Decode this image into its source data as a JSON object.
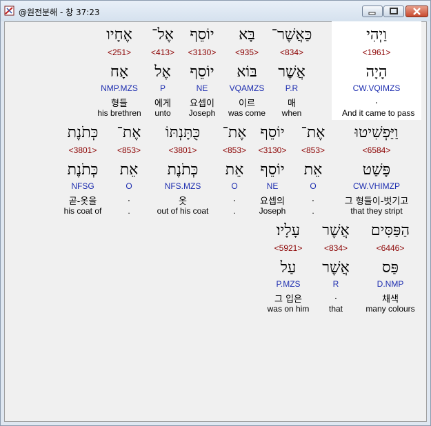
{
  "window": {
    "title": "@원전분해 - 창 37:23",
    "controls": {
      "minimize": "minimize-icon",
      "maximize": "maximize-icon",
      "close": "close-icon"
    },
    "accent": "#8b0000",
    "parse_color": "#1f2fb0"
  },
  "rows": [
    {
      "words": [
        {
          "heb": "וַיְהִי",
          "num": "<1961>",
          "lex": "הָיָה",
          "pars": "CW.VQIMZS",
          "kor": ".",
          "eng": "And it came to pass"
        },
        {
          "heb": "כַּאֲשֶׁר־",
          "num": "<834>",
          "lex": "אֲשֶׁר",
          "pars": "P.R",
          "kor": "매",
          "eng": "when"
        },
        {
          "heb": "בָּא",
          "num": "<935>",
          "lex": "בּוֹא",
          "pars": "VQAMZS",
          "kor": "이르",
          "eng": "was come"
        },
        {
          "heb": "יוֹסֵף",
          "num": "<3130>",
          "lex": "יוֹסֵף",
          "pars": "NE",
          "kor": "요셉이",
          "eng": "Joseph"
        },
        {
          "heb": "אֶל־",
          "num": "<413>",
          "lex": "אֶל",
          "pars": "P",
          "kor": "에게",
          "eng": "unto"
        },
        {
          "heb": "אֶחָיו",
          "num": "<251>",
          "lex": "אָח",
          "pars": "NMP.MZS",
          "kor": "형들",
          "eng": "his brethren"
        }
      ]
    },
    {
      "words": [
        {
          "heb": "וַיַּפְשִׁיטוּ",
          "num": "<6584>",
          "lex": "פָּשַׁט",
          "pars": "CW.VHIMZP",
          "kor": "그 형들이-벗기고",
          "eng": "that they stript"
        },
        {
          "heb": "אֶת־",
          "num": "<853>",
          "lex": "אֵת",
          "pars": "O",
          "kor": ".",
          "eng": "."
        },
        {
          "heb": "יוֹסֵף",
          "num": "<3130>",
          "lex": "יוֹסֵף",
          "pars": "NE",
          "kor": "요셉의",
          "eng": "Joseph"
        },
        {
          "heb": "אֶת־",
          "num": "<853>",
          "lex": "אֵת",
          "pars": "O",
          "kor": ".",
          "eng": "."
        },
        {
          "heb": "כֻּתָּנְתּוֹ",
          "num": "<3801>",
          "lex": "כְּתֹנֶת",
          "pars": "NFS.MZS",
          "kor": "옷",
          "eng": "out of his coat"
        },
        {
          "heb": "אֶת־",
          "num": "<853>",
          "lex": "אֵת",
          "pars": "O",
          "kor": ".",
          "eng": "."
        },
        {
          "heb": "כְּתֹנֶת",
          "num": "<3801>",
          "lex": "כְּתֹנֶת",
          "pars": "NFSG",
          "kor": "곧-옷을",
          "eng": "his coat of"
        }
      ]
    },
    {
      "words": [
        {
          "heb": "הַפַּסִּים",
          "num": "<6446>",
          "lex": "פַּס",
          "pars": "D.NMP",
          "kor": "채색",
          "eng": "many colours"
        },
        {
          "heb": "אֲשֶׁר",
          "num": "<834>",
          "lex": "אֲשֶׁר",
          "pars": "R",
          "kor": ".",
          "eng": "that"
        },
        {
          "heb": "עָלָיו׃",
          "num": "<5921>",
          "lex": "עַל",
          "pars": "P.MZS",
          "kor": "그 입은",
          "eng": "was on him"
        }
      ]
    }
  ]
}
